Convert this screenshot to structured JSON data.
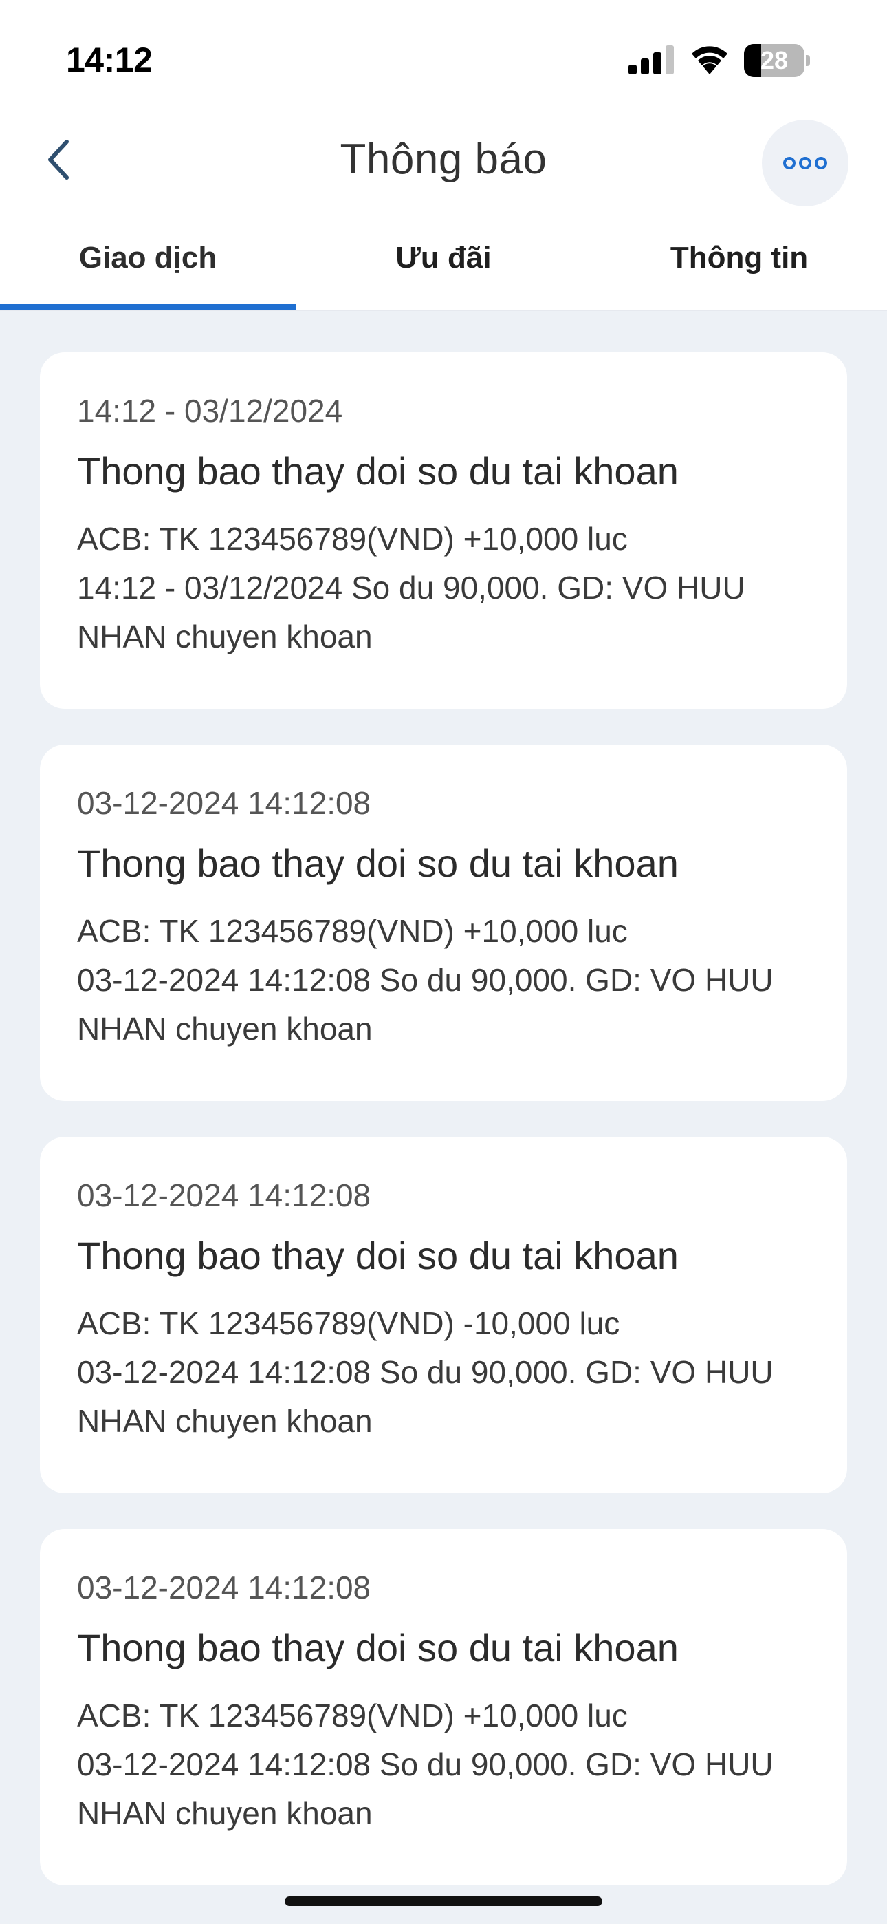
{
  "status_bar": {
    "time": "14:12",
    "battery_level": "28",
    "battery_fraction": 0.28
  },
  "nav": {
    "title": "Thông báo",
    "back_icon": "chevron-left-icon",
    "more_icon": "ellipsis-icon"
  },
  "tabs": [
    {
      "label": "Giao dịch",
      "active": true
    },
    {
      "label": "Ưu đãi",
      "active": false
    },
    {
      "label": "Thông tin",
      "active": false
    }
  ],
  "colors": {
    "accent": "#1f6fd1",
    "background": "#edf1f6",
    "card": "#ffffff"
  },
  "notifications": [
    {
      "time": "14:12 - 03/12/2024",
      "title": "Thong bao thay doi so du tai khoan",
      "line1": "ACB: TK 123456789(VND) +10,000 luc",
      "line2": "14:12 - 03/12/2024 So du 90,000. GD: VO HUU",
      "line3": "NHAN chuyen khoan"
    },
    {
      "time": "03-12-2024 14:12:08",
      "title": "Thong bao thay doi so du tai khoan",
      "line1": "ACB: TK 123456789(VND) +10,000 luc",
      "line2": "03-12-2024 14:12:08 So du 90,000. GD: VO HUU",
      "line3": "NHAN chuyen khoan"
    },
    {
      "time": "03-12-2024 14:12:08",
      "title": "Thong bao thay doi so du tai khoan",
      "line1": "ACB: TK 123456789(VND) -10,000 luc",
      "line2": "03-12-2024 14:12:08 So du 90,000. GD: VO HUU",
      "line3": "NHAN chuyen khoan"
    },
    {
      "time": "03-12-2024 14:12:08",
      "title": "Thong bao thay doi so du tai khoan",
      "line1": "ACB: TK 123456789(VND) +10,000 luc",
      "line2": "03-12-2024 14:12:08 So du 90,000. GD: VO HUU",
      "line3": "NHAN chuyen khoan"
    }
  ]
}
